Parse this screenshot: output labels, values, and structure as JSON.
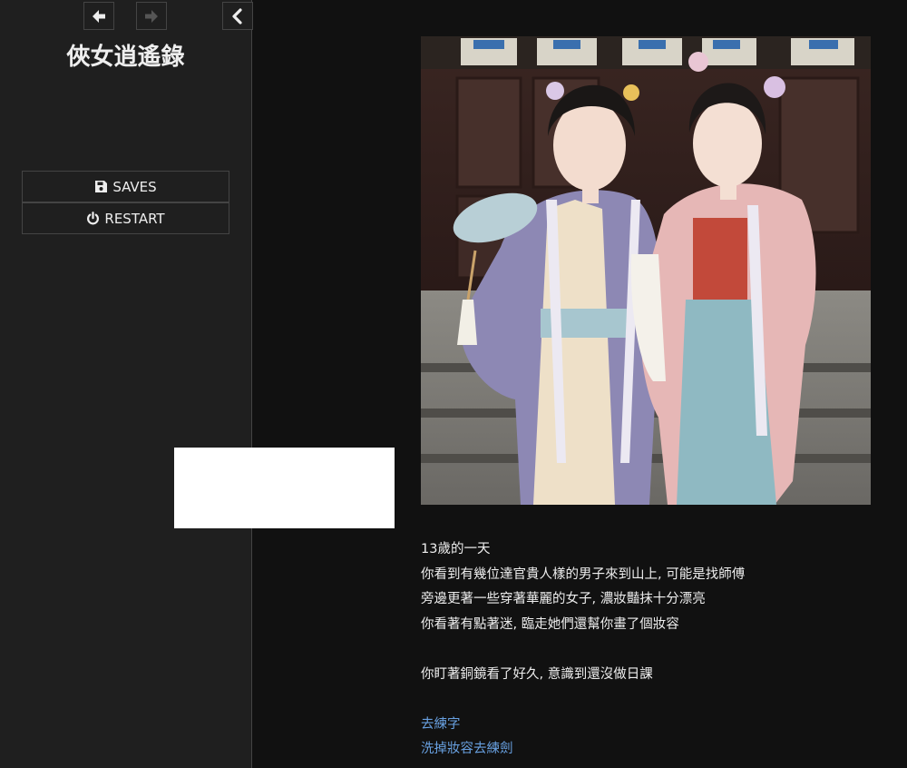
{
  "sidebar": {
    "title": "俠女逍遙錄",
    "saves_label": "SAVES",
    "restart_label": "RESTART",
    "back_icon": "arrow-left-icon",
    "forward_icon": "arrow-right-icon",
    "toggle_icon": "chevron-left-icon"
  },
  "passage": {
    "lines": [
      "13歲的一天",
      "你看到有幾位達官貴人樣的男子來到山上, 可能是找師傅",
      "旁邊更著一些穿著華麗的女子, 濃妝豔抹十分漂亮",
      "你看著有點著迷, 臨走她們還幫你畫了個妝容",
      "你盯著銅鏡看了好久, 意識到還沒做日課"
    ],
    "choices": [
      "去練字",
      "洗掉妝容去練劍"
    ]
  },
  "colors": {
    "page_bg": "#111111",
    "sidebar_bg": "#1f1f1f",
    "border": "#444444",
    "text": "#eeeeee",
    "link": "#68a0e0"
  }
}
